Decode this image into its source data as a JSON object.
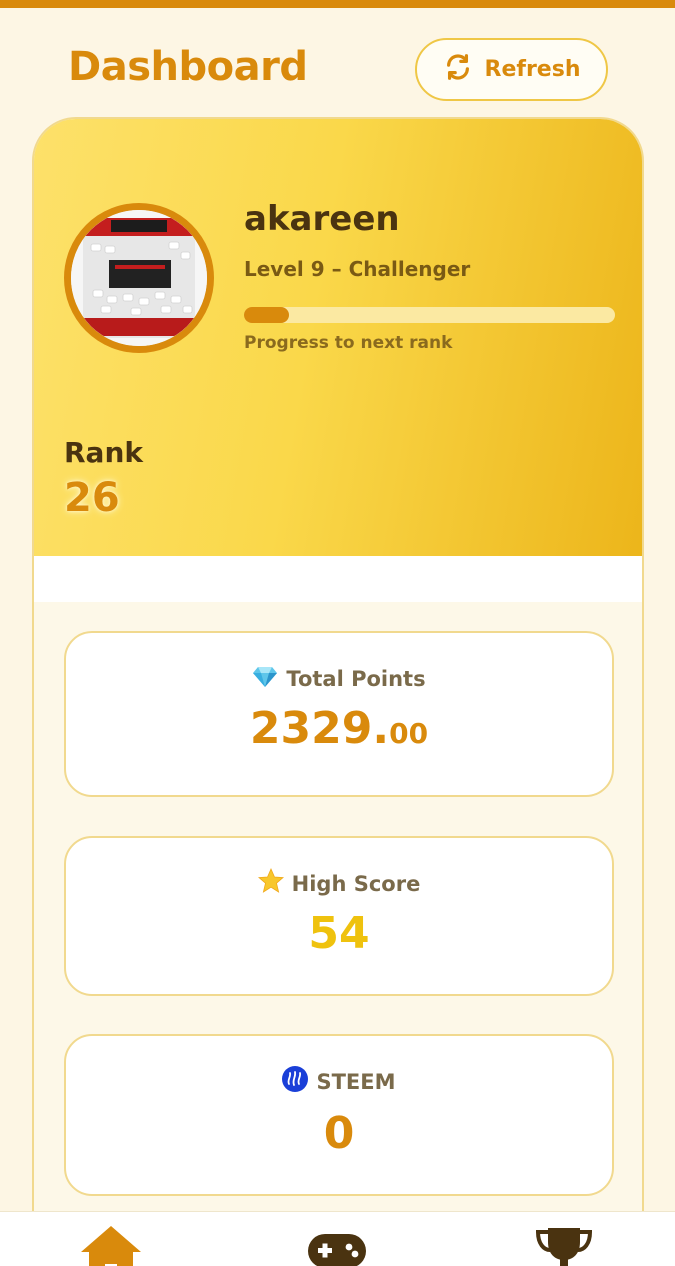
{
  "header": {
    "title": "Dashboard",
    "refresh_label": "Refresh"
  },
  "profile": {
    "username": "akareen",
    "level_text": "Level 9 – Challenger",
    "progress_label": "Progress to next rank",
    "progress_fraction": 0.12,
    "rank_label": "Rank",
    "rank_value": "26"
  },
  "stats": {
    "total_points": {
      "label": "Total Points",
      "value_int": "2329.",
      "value_dec": "00",
      "icon": "gem-icon"
    },
    "high_score": {
      "label": "High Score",
      "value": "54",
      "icon": "star-icon"
    },
    "steem": {
      "label": "STEEM",
      "value": "0",
      "icon": "steem-icon"
    }
  },
  "nav": {
    "items": [
      "home-icon",
      "gamepad-icon",
      "trophy-icon"
    ]
  },
  "colors": {
    "accent": "#d98a0c",
    "gold": "#efc20e",
    "text_dark": "#4a3310"
  }
}
